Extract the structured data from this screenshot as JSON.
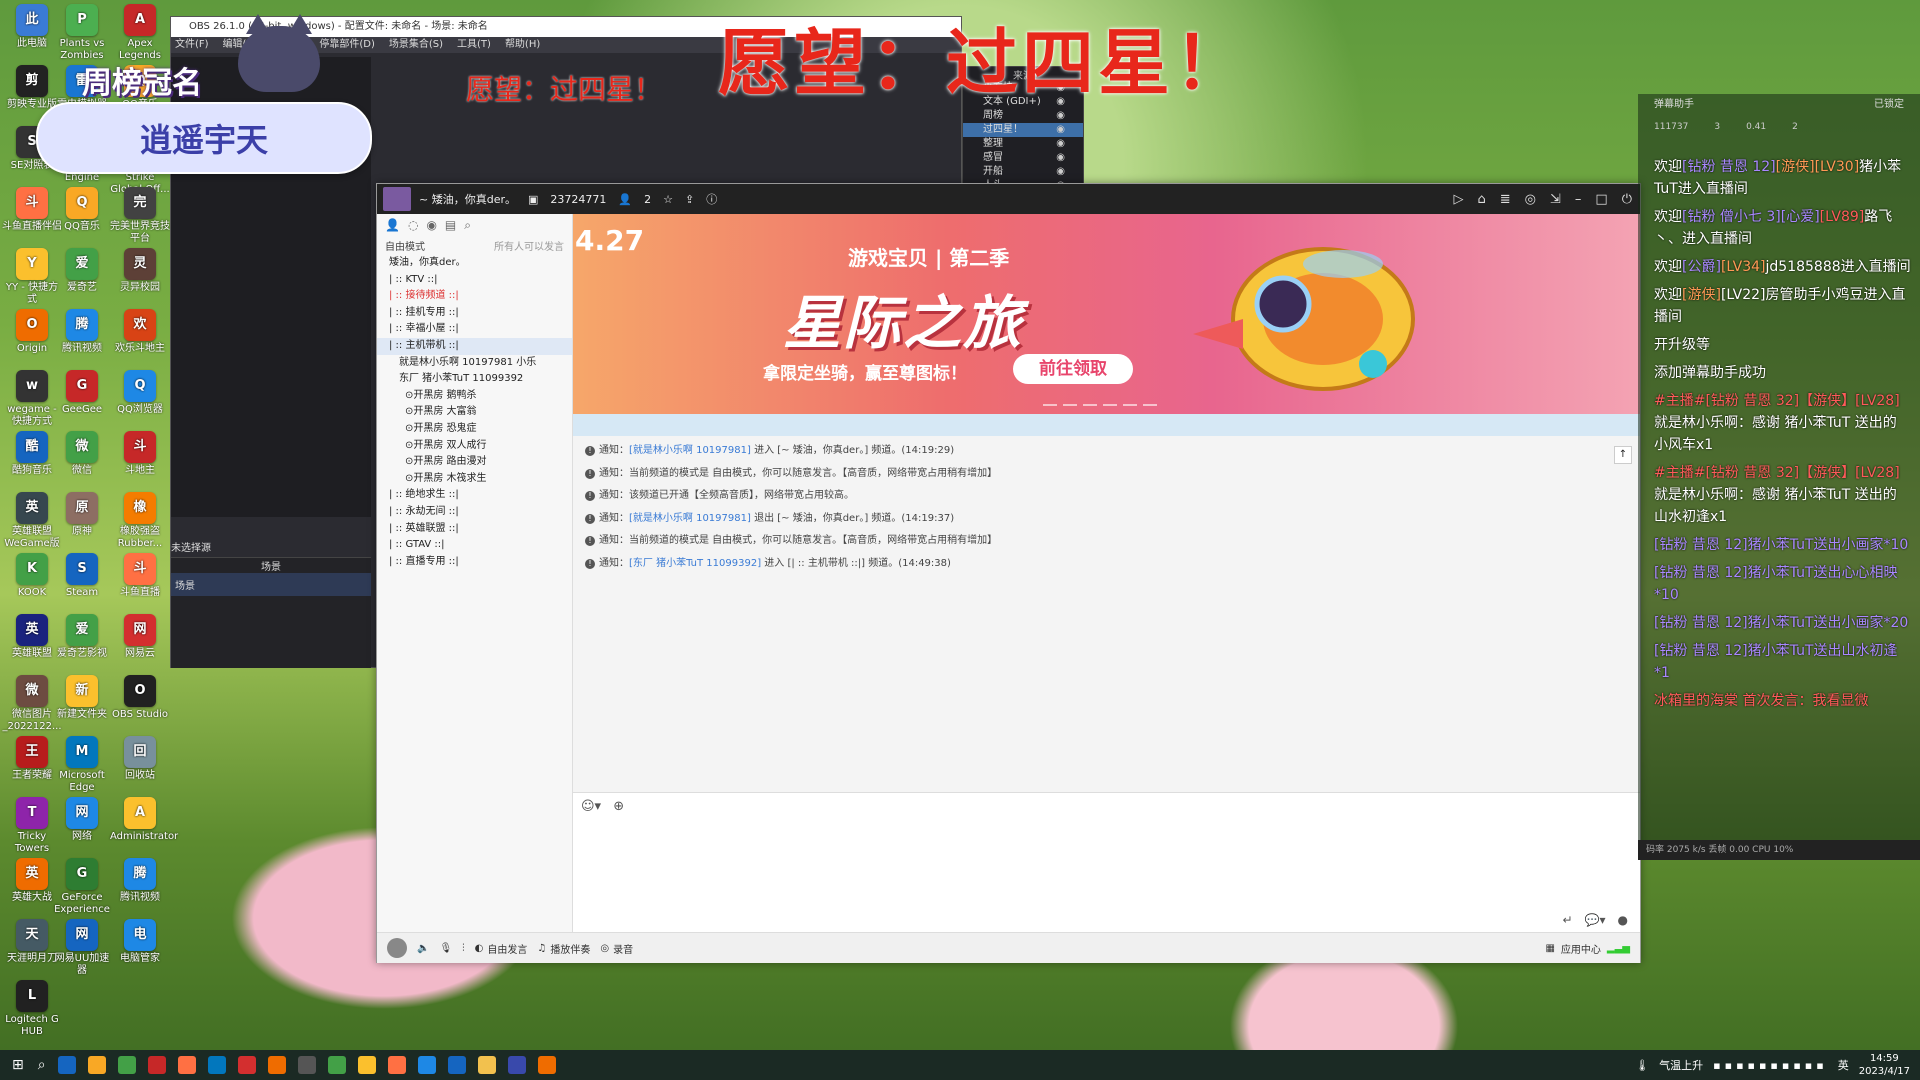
{
  "overlay": {
    "wish_big": "愿望：过四星！",
    "wish_small": "愿望：过四星！",
    "crown_title": "周榜冠名",
    "crown_name": "逍遥宇天"
  },
  "desktop_icons": [
    {
      "label": "此电脑",
      "color": "#3a7bd5"
    },
    {
      "label": "Plants vs Zombies",
      "color": "#4caf50"
    },
    {
      "label": "Apex Legends",
      "color": "#c62828"
    },
    {
      "label": "剪映专业版",
      "color": "#222"
    },
    {
      "label": "雷电模拟器",
      "color": "#1976d2"
    },
    {
      "label": "QQ音乐",
      "color": "#f9a825"
    },
    {
      "label": "SE对照表",
      "color": "#333"
    },
    {
      "label": "Cheat Engine",
      "color": "#2e7d32"
    },
    {
      "label": "Counter-Strike Global Off...",
      "color": "#e65100"
    },
    {
      "label": "斗鱼直播伴侣",
      "color": "#ff7043"
    },
    {
      "label": "QQ音乐",
      "color": "#f9a825"
    },
    {
      "label": "完美世界竞技平台",
      "color": "#424242"
    },
    {
      "label": "YY - 快捷方式",
      "color": "#fbc02d"
    },
    {
      "label": "爱奇艺",
      "color": "#43a047"
    },
    {
      "label": "灵异校园",
      "color": "#5d4037"
    },
    {
      "label": "Origin",
      "color": "#ef6c00"
    },
    {
      "label": "腾讯视频",
      "color": "#1e88e5"
    },
    {
      "label": "欢乐斗地主",
      "color": "#d84315"
    },
    {
      "label": "wegame - 快捷方式",
      "color": "#333"
    },
    {
      "label": "GeeGee",
      "color": "#c62828"
    },
    {
      "label": "QQ浏览器",
      "color": "#1e88e5"
    },
    {
      "label": "酷狗音乐",
      "color": "#1565c0"
    },
    {
      "label": "微信",
      "color": "#43a047"
    },
    {
      "label": "斗地主",
      "color": "#c62828"
    },
    {
      "label": "英雄联盟WeGame版",
      "color": "#37474f"
    },
    {
      "label": "原神",
      "color": "#8d6e63"
    },
    {
      "label": "橡胶强盗 Rubber...",
      "color": "#f57c00"
    },
    {
      "label": "KOOK",
      "color": "#43a047"
    },
    {
      "label": "Steam",
      "color": "#1565c0"
    },
    {
      "label": "斗鱼直播",
      "color": "#ff7043"
    },
    {
      "label": "英雄联盟",
      "color": "#1a237e"
    },
    {
      "label": "爱奇艺影视",
      "color": "#43a047"
    },
    {
      "label": "网易云",
      "color": "#d32f2f"
    },
    {
      "label": "微信图片_2022122...",
      "color": "#6d4c41"
    },
    {
      "label": "新建文件夹",
      "color": "#fbc02d"
    },
    {
      "label": "OBS Studio",
      "color": "#212121"
    },
    {
      "label": "王者荣耀",
      "color": "#b71c1c"
    },
    {
      "label": "Microsoft Edge",
      "color": "#0277bd"
    },
    {
      "label": "回收站",
      "color": "#78909c"
    },
    {
      "label": "Tricky Towers",
      "color": "#8e24aa"
    },
    {
      "label": "网络",
      "color": "#1e88e5"
    },
    {
      "label": "Administrator",
      "color": "#fbc02d"
    },
    {
      "label": "英雄大战",
      "color": "#ef6c00"
    },
    {
      "label": "GeForce Experience",
      "color": "#2e7d32"
    },
    {
      "label": "腾讯视频",
      "color": "#1e88e5"
    },
    {
      "label": "天涯明月刀",
      "color": "#455a64"
    },
    {
      "label": "网易UU加速器",
      "color": "#1565c0"
    },
    {
      "label": "电脑管家",
      "color": "#1e88e5"
    },
    {
      "label": "Logitech G HUB",
      "color": "#212121"
    }
  ],
  "obs": {
    "title": "OBS 26.1.0 (64-bit, windows) - 配置文件: 未命名 - 场景: 未命名",
    "menu": [
      "文件(F)",
      "编辑(E)",
      "视图(V)",
      "停靠部件(D)",
      "场景集合(S)",
      "工具(T)",
      "帮助(H)"
    ],
    "sources_header": "来源",
    "sources": [
      {
        "label": "小方块",
        "selected": false
      },
      {
        "label": "文本 (GDI+)",
        "selected": false
      },
      {
        "label": "周榜",
        "selected": false
      },
      {
        "label": "过四星！",
        "selected": true
      },
      {
        "label": "整理",
        "selected": false
      },
      {
        "label": "感冒",
        "selected": false
      },
      {
        "label": "开船",
        "selected": false
      },
      {
        "label": "人头",
        "selected": false
      }
    ],
    "scene_dock_label": "未选择源",
    "scenes_header": "场景",
    "scene_item": "场景"
  },
  "client": {
    "topbar": {
      "channel": "~ 矮油，你真der。",
      "room_id": "23724771",
      "users": "2",
      "controls": [
        "video-icon",
        "home-icon",
        "list-icon",
        "gamepad-icon",
        "collapse-icon",
        "minimize-icon",
        "maximize-icon",
        "power-icon"
      ]
    },
    "left": {
      "mode": "自由模式",
      "mode_hint": "所有人可以发言",
      "channels": [
        {
          "label": "矮油，你真der。",
          "cls": ""
        },
        {
          "label": "| :: KTV ::|",
          "cls": ""
        },
        {
          "label": "| :: 接待频道 ::|",
          "cls": "red"
        },
        {
          "label": "| :: 挂机专用 ::|",
          "cls": ""
        },
        {
          "label": "| :: 幸福小屋 ::|",
          "cls": ""
        },
        {
          "label": "| :: 主机带机 ::|",
          "cls": "sel"
        },
        {
          "label": "就是林小乐啊 10197981  小乐",
          "cls": "user"
        },
        {
          "label": "东厂 猪小苯TuT 11099392",
          "cls": "user"
        },
        {
          "label": "⊙开黑房  鹅鸭杀",
          "cls": "sub"
        },
        {
          "label": "⊙开黑房  大富翁",
          "cls": "sub"
        },
        {
          "label": "⊙开黑房  恐鬼症",
          "cls": "sub"
        },
        {
          "label": "⊙开黑房  双人成行",
          "cls": "sub"
        },
        {
          "label": "⊙开黑房  路由漫对",
          "cls": "sub"
        },
        {
          "label": "⊙开黑房  木筏求生",
          "cls": "sub"
        },
        {
          "label": "| :: 绝地求生 ::|",
          "cls": ""
        },
        {
          "label": "| :: 永劫无间 ::|",
          "cls": ""
        },
        {
          "label": "| :: 英雄联盟 ::|",
          "cls": ""
        },
        {
          "label": "| :: GTAV ::|",
          "cls": ""
        },
        {
          "label": "| :: 直播专用 ::|",
          "cls": ""
        }
      ]
    },
    "banner": {
      "date": "4.27",
      "subtitle": "游戏宝贝 | 第二季",
      "title": "星际之旅",
      "promo": "拿限定坐骑，赢至尊图标！",
      "cta": "前往领取"
    },
    "messages": [
      {
        "prefix": "通知：",
        "link": "[就是林小乐啊  10197981]",
        "text": " 进入 [~ 矮油，你真der。] 频道。(14:19:29)"
      },
      {
        "prefix": "通知：",
        "link": "",
        "text": "当前频道的模式是 自由模式，你可以随意发言。【高音质，网络带宽占用稍有增加】"
      },
      {
        "prefix": "通知：",
        "link": "",
        "text": "该频道已开通【全频高音质】，网络带宽占用较高。"
      },
      {
        "prefix": "通知：",
        "link": "[就是林小乐啊  10197981]",
        "text": " 退出 [~ 矮油，你真der。] 频道。(14:19:37)"
      },
      {
        "prefix": "通知：",
        "link": "",
        "text": "当前频道的模式是 自由模式，你可以随意发言。【高音质，网络带宽占用稍有增加】"
      },
      {
        "prefix": "通知：",
        "link": "[东厂 猪小苯TuT 11099392]",
        "text": " 进入 [| :: 主机带机 ::|] 频道。(14:49:38)"
      }
    ],
    "bottom": {
      "free_speak": "自由发言",
      "accompany": "播放伴奏",
      "record": "录音",
      "app_center": "应用中心"
    }
  },
  "danmu": {
    "title": "弹幕助手",
    "status": "已锁定",
    "stats": [
      "111737",
      "3",
      "0.41",
      "2"
    ],
    "lines": [
      {
        "segments": [
          {
            "t": "欢迎",
            "c": ""
          },
          {
            "t": "[钻粉 昔恩 12]",
            "c": "purple"
          },
          {
            "t": "[游侠]",
            "c": "orange"
          },
          {
            "t": "[LV30]",
            "c": "orange"
          },
          {
            "t": "猪小苯TuT进入直播间",
            "c": ""
          }
        ]
      },
      {
        "segments": [
          {
            "t": "欢迎",
            "c": ""
          },
          {
            "t": "[钻粉 僧小七 3]",
            "c": "purple"
          },
          {
            "t": "[心爱]",
            "c": "purple"
          },
          {
            "t": "[LV89]",
            "c": "red"
          },
          {
            "t": "路飞丶、进入直播间",
            "c": ""
          }
        ]
      },
      {
        "segments": [
          {
            "t": "欢迎",
            "c": ""
          },
          {
            "t": "[公爵]",
            "c": "purple"
          },
          {
            "t": "[LV34]",
            "c": "orange"
          },
          {
            "t": "jd5185888进入直播间",
            "c": ""
          }
        ]
      },
      {
        "segments": [
          {
            "t": "欢迎",
            "c": ""
          },
          {
            "t": "[游侠]",
            "c": "orange"
          },
          {
            "t": "[LV22]房管助手小鸡豆进入直播间",
            "c": ""
          }
        ]
      },
      {
        "segments": [
          {
            "t": "开升级等",
            "c": ""
          }
        ]
      },
      {
        "segments": [
          {
            "t": "添加弹幕助手成功",
            "c": ""
          }
        ]
      },
      {
        "segments": [
          {
            "t": "#主播#[钻粉 昔恩 32]【游侠】[LV28]",
            "c": "red"
          },
          {
            "t": "就是林小乐啊：感谢 猪小苯TuT 送出的 小风车x1",
            "c": ""
          }
        ]
      },
      {
        "segments": [
          {
            "t": "#主播#[钻粉 昔恩 32]【游侠】[LV28]",
            "c": "red"
          },
          {
            "t": "就是林小乐啊：感谢 猪小苯TuT 送出的 山水初逢x1",
            "c": ""
          }
        ]
      },
      {
        "segments": [
          {
            "t": "[钻粉 昔恩 12]猪小苯TuT送出小画家*10",
            "c": "purple"
          }
        ]
      },
      {
        "segments": [
          {
            "t": "[钻粉 昔恩 12]猪小苯TuT送出心心相映*10",
            "c": "purple"
          }
        ]
      },
      {
        "segments": [
          {
            "t": "[钻粉 昔恩 12]猪小苯TuT送出小画家*20",
            "c": "purple"
          }
        ]
      },
      {
        "segments": [
          {
            "t": "[钻粉 昔恩 12]猪小苯TuT送出山水初逢*1",
            "c": "purple"
          }
        ]
      },
      {
        "segments": [
          {
            "t": "冰箱里的海棠 首次发言：我看显微",
            "c": "red"
          }
        ]
      }
    ],
    "footer": "码率 2075 k/s  丢帧 0.00  CPU 10%"
  },
  "taskbar": {
    "weather": "气温上升",
    "ime": "英",
    "time": "14:59",
    "date": "2023/4/17"
  }
}
